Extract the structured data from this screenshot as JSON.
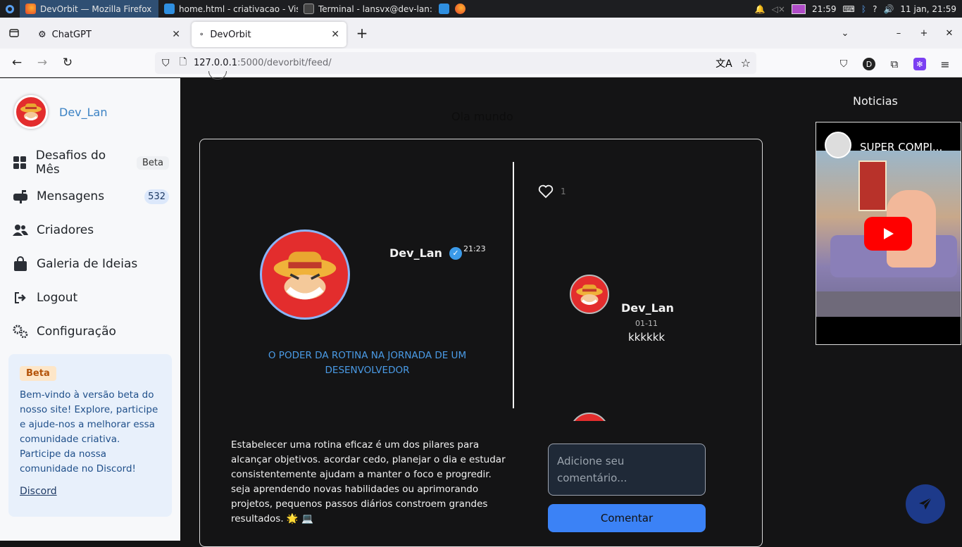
{
  "taskbar": {
    "tasks": [
      {
        "label": "DevOrbit — Mozilla Firefox"
      },
      {
        "label": "home.html - criativacao - Vis..."
      },
      {
        "label": "Terminal - lansvx@dev-lan: ..."
      }
    ],
    "time": "21:59",
    "date": "11 jan, 21:59"
  },
  "browser": {
    "tabs": [
      {
        "label": "ChatGPT"
      },
      {
        "label": "DevOrbit"
      }
    ],
    "url_host": "127.0.0.1",
    "url_path": ":5000/devorbit/feed/",
    "profile_letter": "D"
  },
  "sidebar": {
    "username": "Dev_Lan",
    "items": [
      {
        "label": "Desafios do Mês",
        "badge": "Beta"
      },
      {
        "label": "Mensagens",
        "count": "532"
      },
      {
        "label": "Criadores"
      },
      {
        "label": "Galeria de Ideias"
      },
      {
        "label": "Logout"
      },
      {
        "label": "Configuração"
      }
    ],
    "beta_card": {
      "tag": "Beta",
      "text": "Bem-vindo à versão beta do nosso site! Explore, participe e ajude-nos a melhorar essa comunidade criativa. Participe da nossa comunidade no Discord!",
      "link": "Discord"
    }
  },
  "feed": {
    "title": "Ola mundo",
    "post": {
      "author": "Dev_Lan",
      "time": "21:23",
      "heading": "O PODER DA ROTINA NA JORNADA DE UM DESENVOLVEDOR",
      "likes": "1",
      "body": "Estabelecer uma rotina eficaz é um dos pilares para alcançar objetivos. acordar cedo, planejar o dia e estudar consistentemente ajudam a manter o foco e progredir. seja aprendendo novas habilidades ou aprimorando projetos, pequenos passos diários constroem grandes resultados. 🌟 💻",
      "comments": [
        {
          "author": "Dev_Lan",
          "date": "01-11",
          "text": "kkkkkk"
        }
      ],
      "comment_placeholder": "Adicione seu comentário...",
      "comment_button": "Comentar"
    }
  },
  "news": {
    "title": "Noticias",
    "video_title": "SUPER COMPI..."
  }
}
